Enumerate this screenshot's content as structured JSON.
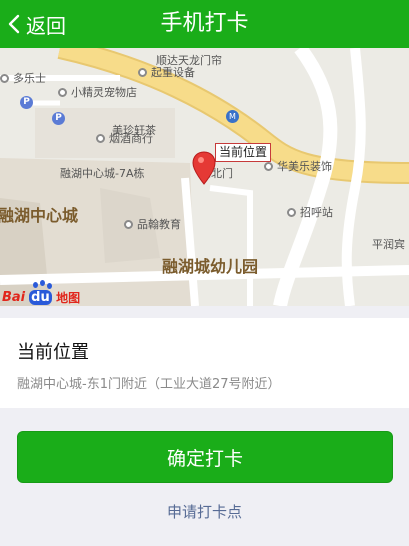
{
  "header": {
    "back_label": "返回",
    "title": "手机打卡"
  },
  "map": {
    "current_marker_label": "当前位置",
    "pois": {
      "duolezhi": "多乐士",
      "shunda": "顺达天龙门帘",
      "qichong": "起重设备",
      "pet": "小精灵宠物店",
      "meizhen": "美珍轩茶",
      "yanjiu": "烟酒商行",
      "rongcenter7a": "融湖中心城-7A栋",
      "dongbeimen": "东北门",
      "huamei": "华美乐装饰",
      "rongcenter": "融湖中心城",
      "zhaoxinzhan": "招呼站",
      "pinhan": "品翰教育",
      "kindergarten": "融湖城幼儿园",
      "pingrun": "平润宾"
    },
    "logo": {
      "bai": "Bai",
      "du": "du",
      "map": "地图"
    }
  },
  "location": {
    "title": "当前位置",
    "address": "融湖中心城-东1门附近（工业大道27号附近）"
  },
  "actions": {
    "confirm_label": "确定打卡",
    "apply_label": "申请打卡点"
  }
}
